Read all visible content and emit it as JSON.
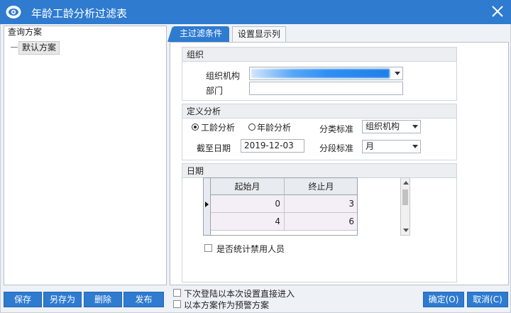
{
  "window": {
    "title": "年龄工龄分析过滤表"
  },
  "left": {
    "header": "查询方案",
    "tree_item": "默认方案"
  },
  "tabs": {
    "main": "主过滤条件",
    "display": "设置显示列"
  },
  "org_group": {
    "title": "组织",
    "org_label": "组织机构",
    "org_value": "",
    "dept_label": "部门",
    "dept_value": ""
  },
  "def_group": {
    "title": "定义分析",
    "radio_seniority": "工龄分析",
    "radio_age": "年龄分析",
    "selected": "工龄分析",
    "class_label": "分类标准",
    "class_value": "组织机构",
    "deadline_label": "截至日期",
    "deadline_value": "2019-12-03",
    "segment_label": "分段标准",
    "segment_value": "月"
  },
  "date_group": {
    "title": "日期",
    "columns": [
      "起始月",
      "终止月"
    ],
    "rows": [
      [
        "0",
        "3"
      ],
      [
        "4",
        "6"
      ]
    ],
    "include_disabled_label": "是否统计禁用人员"
  },
  "footer": {
    "save": "保存",
    "save_as": "另存为",
    "delete": "删除",
    "publish": "发布",
    "next_login_label": "下次登陆以本次设置直接进入",
    "as_warning_label": "以本方案作为预警方案",
    "ok": "确定(O)",
    "cancel": "取消(C)"
  },
  "colors": {
    "accent": "#2e7bd0",
    "titlebar": "#2e7bd0"
  }
}
